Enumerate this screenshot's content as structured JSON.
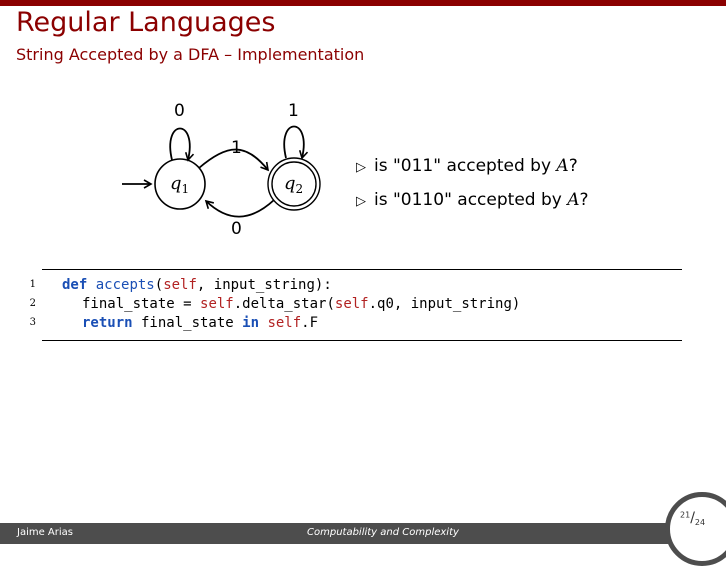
{
  "slide": {
    "title": "Regular Languages",
    "subtitle": "String Accepted by a DFA – Implementation"
  },
  "dfa": {
    "states": [
      {
        "label": "q",
        "subscript": "1",
        "initial": true,
        "accepting": false
      },
      {
        "label": "q",
        "subscript": "2",
        "initial": false,
        "accepting": true
      }
    ],
    "transitions": [
      {
        "from": "q1",
        "to": "q1",
        "symbol": "0"
      },
      {
        "from": "q2",
        "to": "q2",
        "symbol": "1"
      },
      {
        "from": "q1",
        "to": "q2",
        "symbol": "1"
      },
      {
        "from": "q2",
        "to": "q1",
        "symbol": "0"
      }
    ]
  },
  "questions": [
    {
      "prefix": "is \"011\" accepted by ",
      "var": "A",
      "suffix": "?"
    },
    {
      "prefix": "is \"0110\" accepted by ",
      "var": "A",
      "suffix": "?"
    }
  ],
  "code": {
    "line_numbers": [
      "1",
      "2",
      "3"
    ]
  },
  "footer": {
    "author": "Jaime Arias",
    "course": "Computability and Complexity",
    "page_current": "21",
    "page_total": "24"
  }
}
